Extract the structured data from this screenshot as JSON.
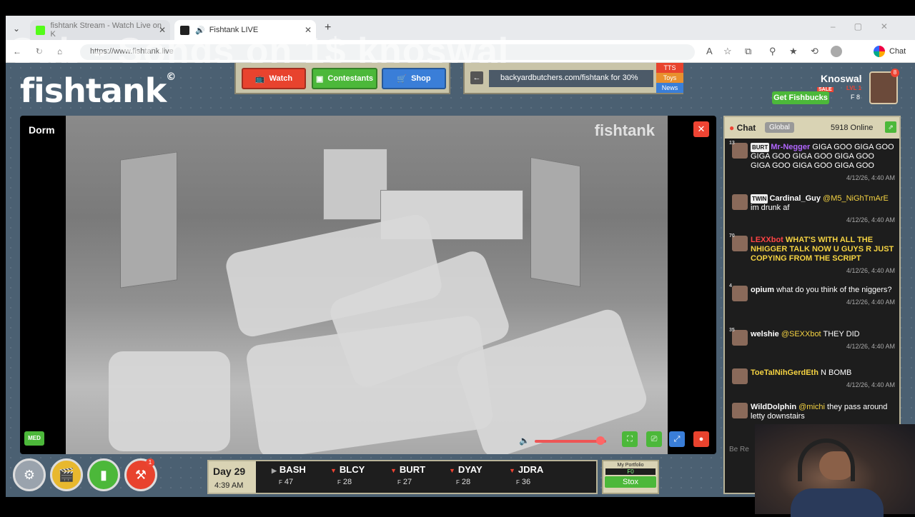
{
  "browser": {
    "tabs": [
      {
        "title": "fishtank Stream - Watch Live on K",
        "favicon_color": "#53fc18"
      },
      {
        "title": "Fishtank LIVE",
        "favicon_color": "#222222"
      }
    ],
    "url": "https://www.fishtank.live",
    "overlay_text": "Sub - Songs on 1$ knoswal",
    "copilot_label": "Chat"
  },
  "site": {
    "logo": "fishtank",
    "logo_mark": "©",
    "nav": {
      "watch": "Watch",
      "contestants": "Contestants",
      "shop": "Shop"
    },
    "ticker": {
      "text": "backyardbutchers.com/fishtank for 30%",
      "tags": [
        "TTS",
        "Toys",
        "News"
      ]
    },
    "user": {
      "name": "Knoswal",
      "fishbucks_label": "Get Fishbucks",
      "sale": "SALE",
      "level": "LVL 1",
      "fish": "F 8",
      "notif_count": "8"
    }
  },
  "video": {
    "room": "Dorm",
    "watermark": "fishtank",
    "quality": "MED",
    "volume_fraction": 0.92
  },
  "bottom": {
    "notif_count": "1",
    "day": "Day 29",
    "time": "4:39 AM",
    "stocks": [
      {
        "name": "BASH",
        "price": "47",
        "trend": "neutral"
      },
      {
        "name": "BLCY",
        "price": "28",
        "trend": "down"
      },
      {
        "name": "BURT",
        "price": "27",
        "trend": "down"
      },
      {
        "name": "DYAY",
        "price": "28",
        "trend": "down"
      },
      {
        "name": "JDRA",
        "price": "36",
        "trend": "down"
      }
    ],
    "currency_symbol": "F",
    "portfolio": {
      "label": "My Portfolio",
      "value": "F0",
      "stox": "Stox"
    }
  },
  "chat": {
    "title": "Chat",
    "scope": "Global",
    "online": "5918 Online",
    "input_placeholder": "Be Re",
    "messages": [
      {
        "level": "13",
        "tag": "BURT",
        "user": "Mr-Negger",
        "user_color": "#b266ff",
        "text": "GIGA GOO GIGA GOO GIGA GOO GIGA GOO GIGA GOO GIGA GOO GIGA GOO GIGA GOO",
        "time": "4/12/26, 4:40 AM"
      },
      {
        "level": "",
        "tag": "TWIN",
        "user": "Cardinal_Guy",
        "user_color": "#ffffff",
        "mention": "@M5_NiGhTmArE",
        "text": "im drunk af",
        "time": "4/12/26, 4:40 AM"
      },
      {
        "level": "70",
        "tag": "",
        "user": "LEXXbot",
        "user_color": "#ff4444",
        "text": "WHAT'S WITH ALL THE NHIGGER TALK NOW U GUYS R JUST COPYING FROM THE SCRIPT",
        "text_color": "#f5d342",
        "time": "4/12/26, 4:40 AM"
      },
      {
        "level": "4",
        "tag": "",
        "user": "opium",
        "user_color": "#ffffff",
        "text": "what do you think of the niggers?",
        "time": "4/12/26, 4:40 AM"
      },
      {
        "level": "35",
        "tag": "",
        "user": "welshie",
        "user_color": "#ffffff",
        "mention": "@SEXXbot",
        "text": "THEY DID",
        "time": "4/12/26, 4:40 AM"
      },
      {
        "level": "",
        "tag": "",
        "user": "ToeTalNihGerdEth",
        "user_color": "#f5d342",
        "text": "N BOMB",
        "time": "4/12/26, 4:40 AM"
      },
      {
        "level": "",
        "tag": "",
        "user": "WildDolphin",
        "user_color": "#ffffff",
        "mention": "@michi",
        "text": "they pass around letty downstairs",
        "time": ""
      }
    ]
  }
}
